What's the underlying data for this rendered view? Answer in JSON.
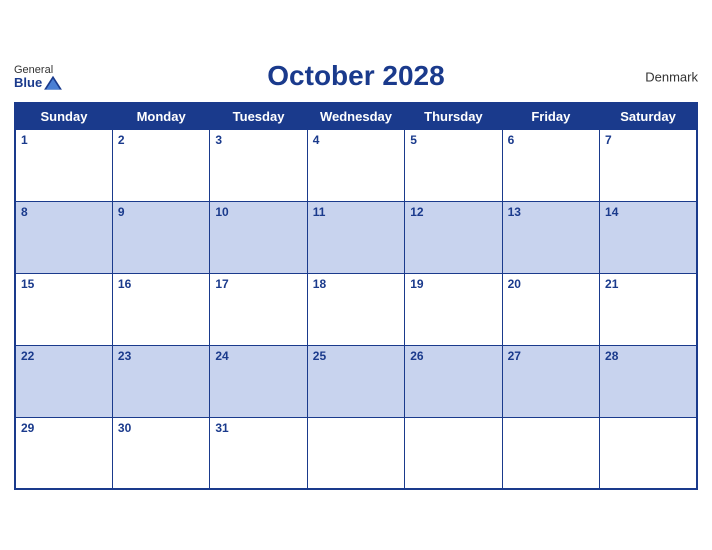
{
  "header": {
    "logo_general": "General",
    "logo_blue": "Blue",
    "month_title": "October 2028",
    "country": "Denmark"
  },
  "weekdays": [
    "Sunday",
    "Monday",
    "Tuesday",
    "Wednesday",
    "Thursday",
    "Friday",
    "Saturday"
  ],
  "weeks": [
    [
      {
        "date": "1",
        "empty": false
      },
      {
        "date": "2",
        "empty": false
      },
      {
        "date": "3",
        "empty": false
      },
      {
        "date": "4",
        "empty": false
      },
      {
        "date": "5",
        "empty": false
      },
      {
        "date": "6",
        "empty": false
      },
      {
        "date": "7",
        "empty": false
      }
    ],
    [
      {
        "date": "8",
        "empty": false
      },
      {
        "date": "9",
        "empty": false
      },
      {
        "date": "10",
        "empty": false
      },
      {
        "date": "11",
        "empty": false
      },
      {
        "date": "12",
        "empty": false
      },
      {
        "date": "13",
        "empty": false
      },
      {
        "date": "14",
        "empty": false
      }
    ],
    [
      {
        "date": "15",
        "empty": false
      },
      {
        "date": "16",
        "empty": false
      },
      {
        "date": "17",
        "empty": false
      },
      {
        "date": "18",
        "empty": false
      },
      {
        "date": "19",
        "empty": false
      },
      {
        "date": "20",
        "empty": false
      },
      {
        "date": "21",
        "empty": false
      }
    ],
    [
      {
        "date": "22",
        "empty": false
      },
      {
        "date": "23",
        "empty": false
      },
      {
        "date": "24",
        "empty": false
      },
      {
        "date": "25",
        "empty": false
      },
      {
        "date": "26",
        "empty": false
      },
      {
        "date": "27",
        "empty": false
      },
      {
        "date": "28",
        "empty": false
      }
    ],
    [
      {
        "date": "29",
        "empty": false
      },
      {
        "date": "30",
        "empty": false
      },
      {
        "date": "31",
        "empty": false
      },
      {
        "date": "",
        "empty": true
      },
      {
        "date": "",
        "empty": true
      },
      {
        "date": "",
        "empty": true
      },
      {
        "date": "",
        "empty": true
      }
    ]
  ],
  "colors": {
    "header_bg": "#1a3a8c",
    "row_alt": "#c8d3ee",
    "row_normal": "#ffffff"
  }
}
